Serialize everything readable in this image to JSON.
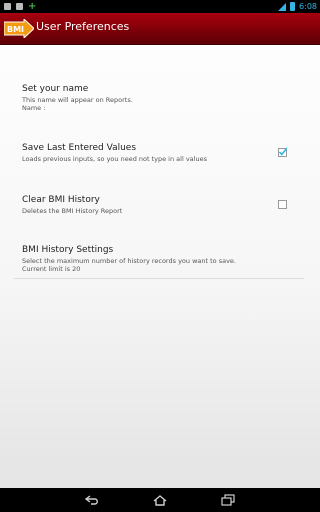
{
  "status_bar": {
    "time": "6:08",
    "left_icons": [
      "notification-icon",
      "notification-icon",
      "add-icon"
    ],
    "right_icons": [
      "signal-icon",
      "battery-icon"
    ]
  },
  "action_bar": {
    "logo_text": "BMI",
    "title": "User Preferences",
    "background": "#8a000a"
  },
  "preferences": [
    {
      "title": "Set your name",
      "summary_lines": [
        "This name will appear on Reports.",
        "Name :"
      ]
    },
    {
      "title": "Save Last Entered Values",
      "summary_lines": [
        "Loads previous inputs, so you need not type in all values"
      ],
      "checked": true
    },
    {
      "title": "Clear BMI History",
      "summary_lines": [
        "Deletes the BMI History Report"
      ],
      "checked": false
    },
    {
      "title": "BMI History Settings",
      "summary_lines": [
        "Select the maximum number of history records you want to save.",
        "Current limit is 20"
      ]
    }
  ],
  "nav_bar": {
    "buttons": [
      "back-icon",
      "home-icon",
      "recent-apps-icon"
    ]
  },
  "colors": {
    "accent_check": "#33b5e5",
    "status_clock": "#33b5e5"
  }
}
